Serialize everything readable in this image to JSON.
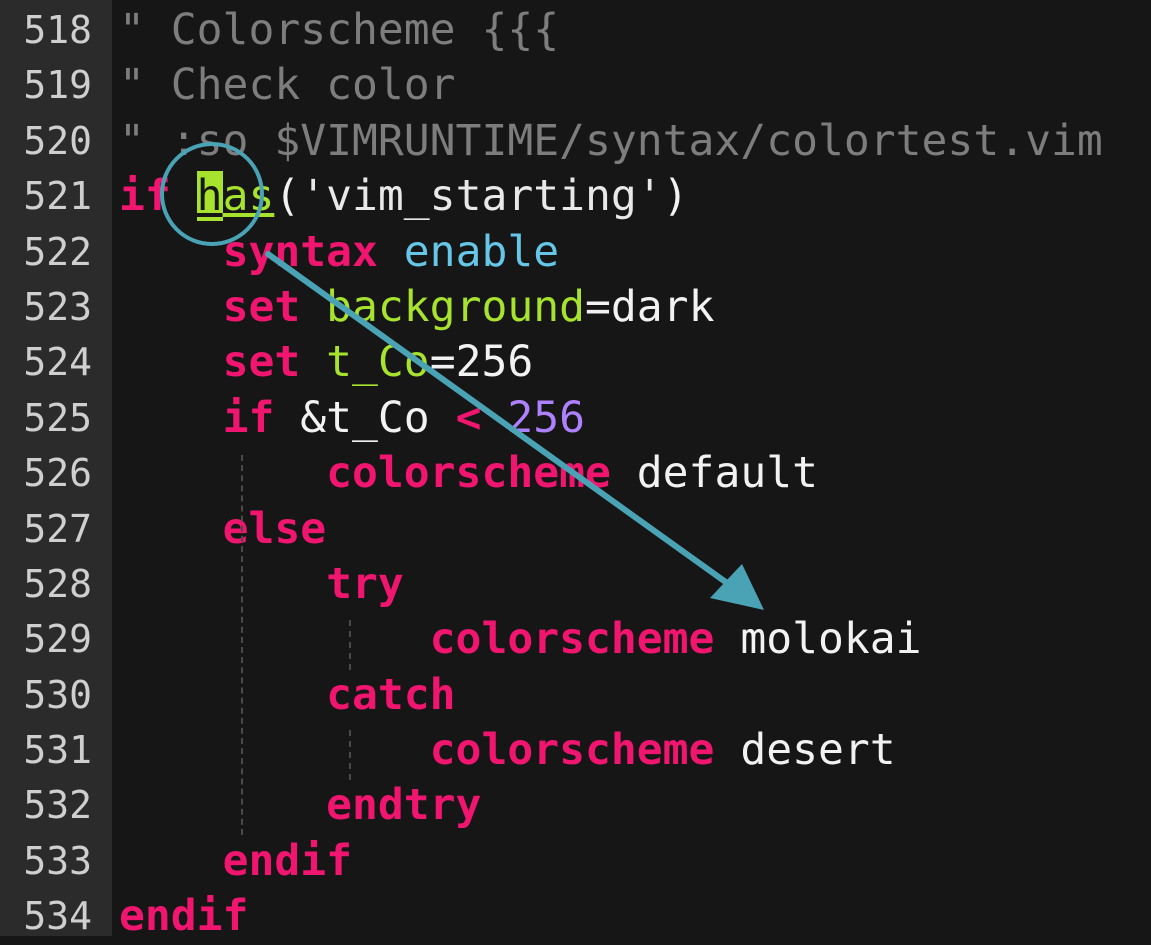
{
  "editor": {
    "lines": [
      {
        "number": "518",
        "tokens": [
          {
            "t": "\" ",
            "c": "comment"
          },
          {
            "t": "Colorscheme {{{",
            "c": "comment"
          }
        ]
      },
      {
        "number": "519",
        "tokens": [
          {
            "t": "\" ",
            "c": "comment"
          },
          {
            "t": "Check color",
            "c": "comment"
          }
        ]
      },
      {
        "number": "520",
        "tokens": [
          {
            "t": "\" ",
            "c": "comment"
          },
          {
            "t": ":so $VIMRUNTIME/syntax/colortest.vim",
            "c": "comment"
          }
        ]
      },
      {
        "number": "521",
        "tokens": [
          {
            "t": "if",
            "c": "kw"
          },
          {
            "t": " ",
            "c": "plain"
          },
          {
            "t": "h",
            "c": "cursor"
          },
          {
            "t": "as",
            "c": "hasrest"
          },
          {
            "t": "(",
            "c": "op"
          },
          {
            "t": "'vim_starting'",
            "c": "str2"
          },
          {
            "t": ")",
            "c": "op"
          }
        ]
      },
      {
        "number": "522",
        "tokens": [
          {
            "t": "    ",
            "c": "plain"
          },
          {
            "t": "syntax",
            "c": "kw"
          },
          {
            "t": " ",
            "c": "plain"
          },
          {
            "t": "enable",
            "c": "type"
          }
        ]
      },
      {
        "number": "523",
        "tokens": [
          {
            "t": "    ",
            "c": "plain"
          },
          {
            "t": "set",
            "c": "kw"
          },
          {
            "t": " ",
            "c": "plain"
          },
          {
            "t": "background",
            "c": "fn"
          },
          {
            "t": "=dark",
            "c": "plain"
          }
        ]
      },
      {
        "number": "524",
        "tokens": [
          {
            "t": "    ",
            "c": "plain"
          },
          {
            "t": "set",
            "c": "kw"
          },
          {
            "t": " ",
            "c": "plain"
          },
          {
            "t": "t_Co",
            "c": "fn"
          },
          {
            "t": "=256",
            "c": "plain"
          }
        ]
      },
      {
        "number": "525",
        "tokens": [
          {
            "t": "    ",
            "c": "plain"
          },
          {
            "t": "if",
            "c": "kw"
          },
          {
            "t": " &t_Co ",
            "c": "plain"
          },
          {
            "t": "<",
            "c": "kw"
          },
          {
            "t": " ",
            "c": "plain"
          },
          {
            "t": "256",
            "c": "num"
          }
        ]
      },
      {
        "number": "526",
        "tokens": [
          {
            "t": "        ",
            "c": "plain"
          },
          {
            "t": "colorscheme",
            "c": "kw"
          },
          {
            "t": " default",
            "c": "plain"
          }
        ]
      },
      {
        "number": "527",
        "tokens": [
          {
            "t": "    ",
            "c": "plain"
          },
          {
            "t": "else",
            "c": "kw"
          }
        ]
      },
      {
        "number": "528",
        "tokens": [
          {
            "t": "        ",
            "c": "plain"
          },
          {
            "t": "try",
            "c": "kw"
          }
        ]
      },
      {
        "number": "529",
        "tokens": [
          {
            "t": "            ",
            "c": "plain"
          },
          {
            "t": "colorscheme",
            "c": "kw"
          },
          {
            "t": " molokai",
            "c": "plain"
          }
        ]
      },
      {
        "number": "530",
        "tokens": [
          {
            "t": "        ",
            "c": "plain"
          },
          {
            "t": "catch",
            "c": "kw"
          }
        ]
      },
      {
        "number": "531",
        "tokens": [
          {
            "t": "            ",
            "c": "plain"
          },
          {
            "t": "colorscheme",
            "c": "kw"
          },
          {
            "t": " desert",
            "c": "plain"
          }
        ]
      },
      {
        "number": "532",
        "tokens": [
          {
            "t": "        ",
            "c": "plain"
          },
          {
            "t": "endtry",
            "c": "kw"
          }
        ]
      },
      {
        "number": "533",
        "tokens": [
          {
            "t": "    ",
            "c": "plain"
          },
          {
            "t": "endif",
            "c": "kw"
          }
        ]
      },
      {
        "number": "534",
        "tokens": [
          {
            "t": "endif",
            "c": "kw"
          }
        ]
      }
    ]
  },
  "colors": {
    "background": "#161616",
    "gutter": "#2b2b2b",
    "keyword": "#f0156e",
    "function": "#a6e22e",
    "number": "#ae81ff",
    "type": "#66c6e8",
    "comment": "#7d7d7d",
    "annotation": "#4aa3b4"
  }
}
